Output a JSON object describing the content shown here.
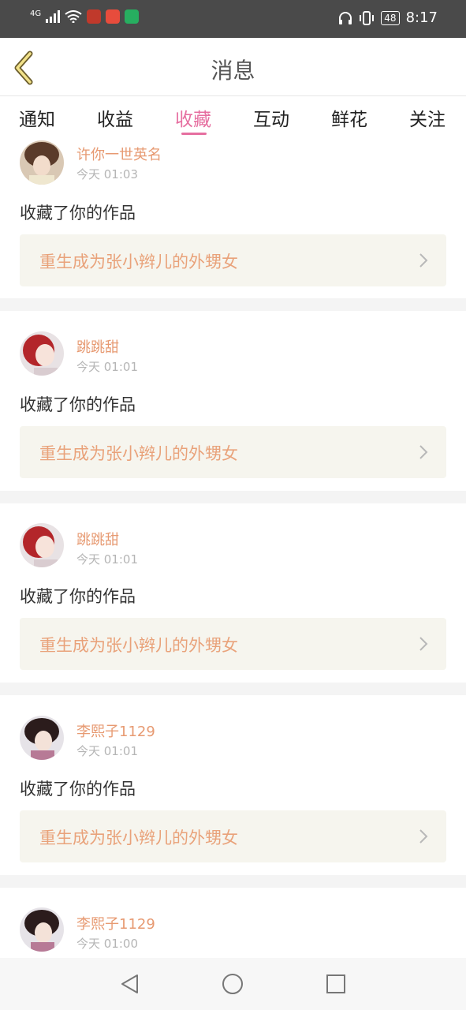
{
  "status_bar": {
    "network": "4G",
    "battery": "48",
    "time": "8:17",
    "icons": [
      "signal-icon",
      "wifi-icon",
      "huawei-app-icon",
      "camera-app-icon",
      "green-app-icon",
      "headphones-icon",
      "vibrate-icon",
      "battery-icon"
    ]
  },
  "header": {
    "title": "消息",
    "back_icon": "chevron-left-icon"
  },
  "tabs": [
    {
      "label": "通知"
    },
    {
      "label": "收益"
    },
    {
      "label": "收藏",
      "active": true
    },
    {
      "label": "互动"
    },
    {
      "label": "鲜花"
    },
    {
      "label": "关注"
    }
  ],
  "feed": [
    {
      "user": "许你一世英名",
      "time": "今天 01:03",
      "action": "收藏了你的作品",
      "work_title": "重生成为张小辫儿的外甥女"
    },
    {
      "user": "跳跳甜",
      "time": "今天 01:01",
      "action": "收藏了你的作品",
      "work_title": "重生成为张小辫儿的外甥女"
    },
    {
      "user": "跳跳甜",
      "time": "今天 01:01",
      "action": "收藏了你的作品",
      "work_title": "重生成为张小辫儿的外甥女"
    },
    {
      "user": "李熙子1129",
      "time": "今天 01:01",
      "action": "收藏了你的作品",
      "work_title": "重生成为张小辫儿的外甥女"
    },
    {
      "user": "李熙子1129",
      "time": "今天 01:00",
      "action": "",
      "work_title": ""
    }
  ],
  "colors": {
    "accent": "#e66fa0",
    "username": "#e79a72",
    "work_title": "#e9a27a",
    "work_bg": "#f6f5ee",
    "status_bar": "#4a4a4a"
  },
  "nav": [
    "back-triangle-icon",
    "home-circle-icon",
    "recent-square-icon"
  ]
}
